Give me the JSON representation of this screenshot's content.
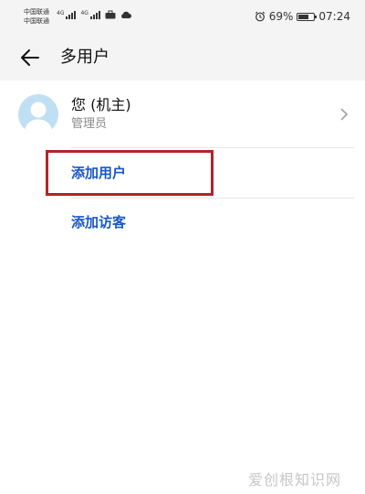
{
  "status_bar": {
    "carrier_1": "中国联通",
    "carrier_2": "中国联通",
    "network_tag_1": "4G",
    "network_tag_2": "4G",
    "battery_percent": "69%",
    "battery_level": 0.69,
    "time": "07:24",
    "icons": [
      "signal-icon",
      "signal-icon",
      "briefcase-icon",
      "cloud-icon",
      "alarm-icon",
      "battery-icon"
    ]
  },
  "header": {
    "back_icon": "arrow-left-icon",
    "title": "多用户"
  },
  "user": {
    "name": "您 (机主)",
    "role": "管理员",
    "avatar_color": "#bfe0f3"
  },
  "actions": {
    "add_user": "添加用户",
    "add_guest": "添加访客",
    "link_color": "#1a56c8",
    "highlight_color": "#b2232c"
  },
  "watermark": "爱创根知识网"
}
